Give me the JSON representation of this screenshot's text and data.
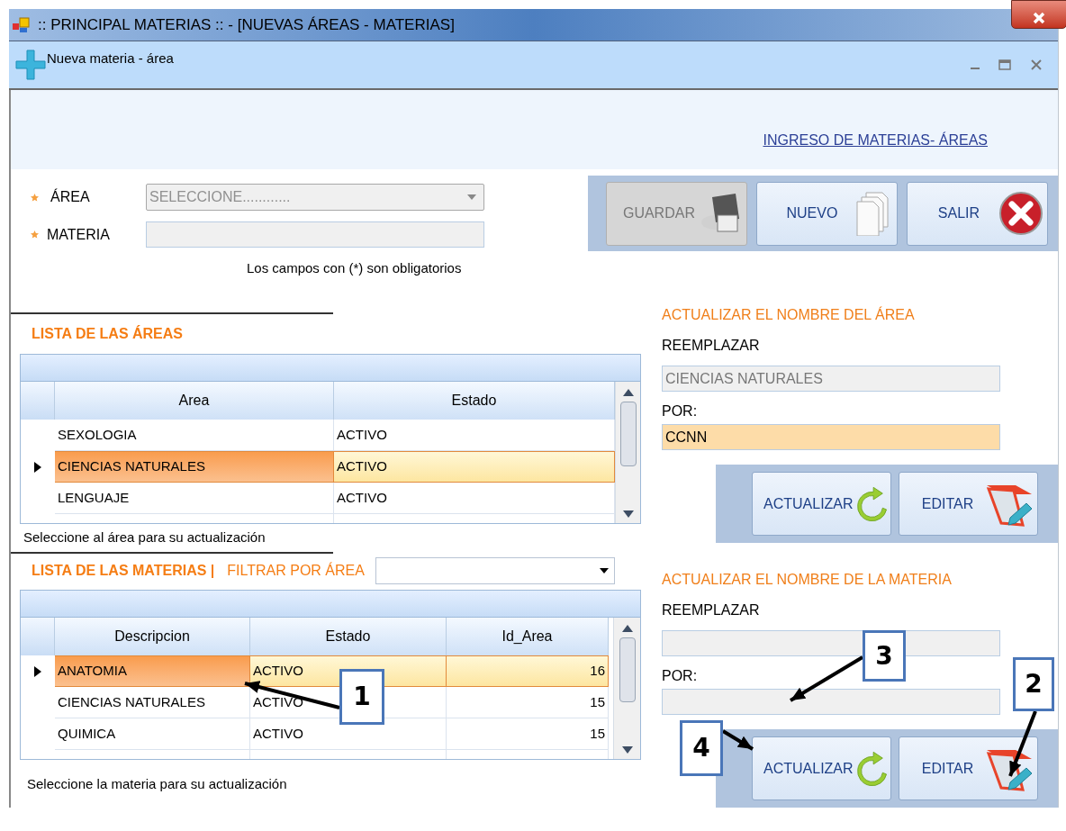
{
  "window": {
    "title": ":: PRINCIPAL MATERIAS :: - [NUEVAS ÁREAS - MATERIAS]"
  },
  "child_window": {
    "title": "Nueva materia - área"
  },
  "header_link": "INGRESO DE MATERIAS- ÁREAS",
  "form": {
    "fields": [
      {
        "label": "ÁREA",
        "kind": "combo",
        "value": "SELECCIONE............",
        "required": true
      },
      {
        "label": "MATERIA",
        "kind": "text",
        "required": true
      }
    ],
    "note": "Los campos con (*) son obligatorios"
  },
  "toolbar": [
    {
      "label": "GUARDAR",
      "kind": "save",
      "disabled": true
    },
    {
      "label": "NUEVO",
      "kind": "new",
      "disabled": false
    },
    {
      "label": "SALIR",
      "kind": "exit",
      "disabled": false
    }
  ],
  "areas": {
    "title": "LISTA DE LAS ÁREAS",
    "columns": [
      "Area",
      "Estado"
    ],
    "rows": [
      {
        "cells": [
          "SEXOLOGIA",
          "ACTIVO"
        ],
        "selected": false
      },
      {
        "cells": [
          "CIENCIAS NATURALES",
          "ACTIVO"
        ],
        "selected": true
      },
      {
        "cells": [
          "LENGUAJE",
          "ACTIVO"
        ],
        "selected": false
      }
    ],
    "note": "Seleccione al área para su actualización"
  },
  "materias": {
    "title": "LISTA DE LAS MATERIAS |",
    "filter_label": "FILTRAR POR ÁREA",
    "columns": [
      "Descripcion",
      "Estado",
      "Id_Area"
    ],
    "rows": [
      {
        "cells": [
          "ANATOMIA",
          "ACTIVO",
          "16"
        ],
        "selected": true
      },
      {
        "cells": [
          "CIENCIAS NATURALES",
          "ACTIVO",
          "15"
        ],
        "selected": false
      },
      {
        "cells": [
          "QUIMICA",
          "ACTIVO",
          "15"
        ],
        "selected": false
      }
    ],
    "note": "Seleccione la materia para su actualización"
  },
  "area_update": {
    "title": "ACTUALIZAR EL NOMBRE DEL ÁREA",
    "replace_label": "REEMPLAZAR",
    "replace_value": "CIENCIAS NATURALES",
    "by_label": "POR:",
    "by_value": "CCNN",
    "by_focused": true,
    "buttons": [
      {
        "label": "ACTUALIZAR",
        "kind": "refresh"
      },
      {
        "label": "EDITAR",
        "kind": "edit"
      }
    ]
  },
  "materia_update": {
    "title": "ACTUALIZAR EL NOMBRE DE LA MATERIA",
    "replace_label": "REEMPLAZAR",
    "by_label": "POR:",
    "by_focused": false,
    "buttons": [
      {
        "label": "ACTUALIZAR",
        "kind": "refresh"
      },
      {
        "label": "EDITAR",
        "kind": "edit"
      }
    ]
  },
  "callouts": [
    {
      "label": "1"
    },
    {
      "label": "2"
    },
    {
      "label": "3"
    },
    {
      "label": "4"
    }
  ]
}
